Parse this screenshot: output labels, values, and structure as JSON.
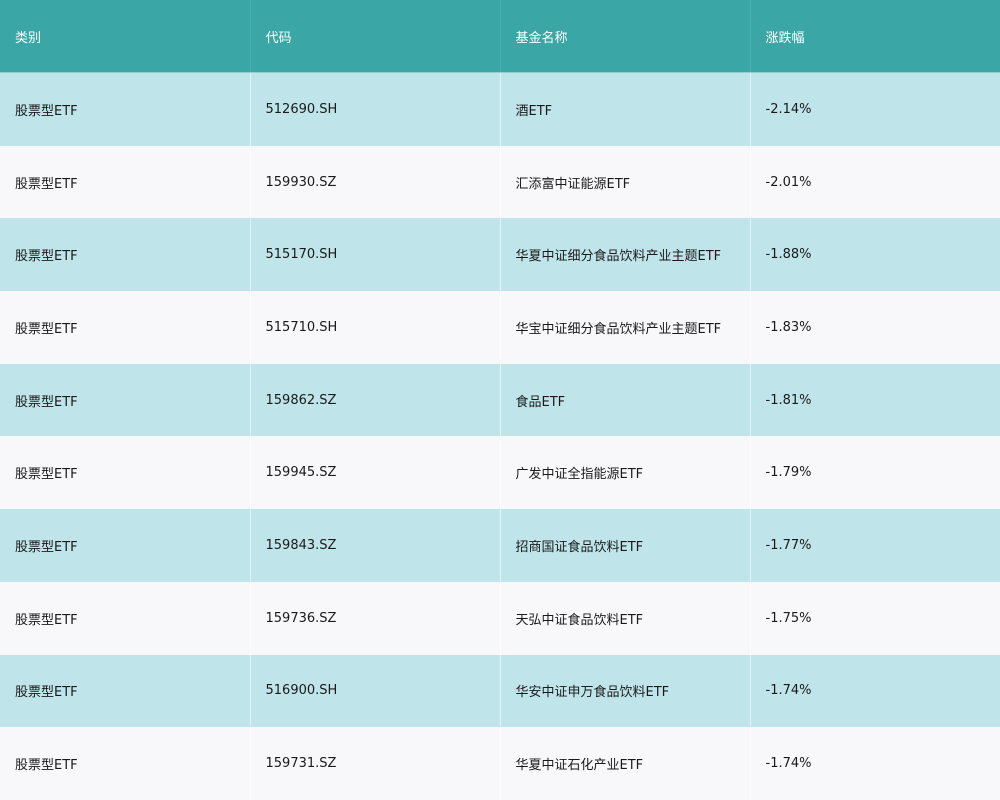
{
  "table": {
    "headers": {
      "category": "类别",
      "code": "代码",
      "name": "基金名称",
      "change": "涨跌幅"
    },
    "rows": [
      {
        "category": "股票型ETF",
        "code": "512690.SH",
        "name": "酒ETF",
        "change": "-2.14%"
      },
      {
        "category": "股票型ETF",
        "code": "159930.SZ",
        "name": "汇添富中证能源ETF",
        "change": "-2.01%"
      },
      {
        "category": "股票型ETF",
        "code": "515170.SH",
        "name": "华夏中证细分食品饮料产业主题ETF",
        "change": "-1.88%"
      },
      {
        "category": "股票型ETF",
        "code": "515710.SH",
        "name": "华宝中证细分食品饮料产业主题ETF",
        "change": "-1.83%"
      },
      {
        "category": "股票型ETF",
        "code": "159862.SZ",
        "name": "食品ETF",
        "change": "-1.81%"
      },
      {
        "category": "股票型ETF",
        "code": "159945.SZ",
        "name": "广发中证全指能源ETF",
        "change": "-1.79%"
      },
      {
        "category": "股票型ETF",
        "code": "159843.SZ",
        "name": "招商国证食品饮料ETF",
        "change": "-1.77%"
      },
      {
        "category": "股票型ETF",
        "code": "159736.SZ",
        "name": "天弘中证食品饮料ETF",
        "change": "-1.75%"
      },
      {
        "category": "股票型ETF",
        "code": "516900.SH",
        "name": "华安中证申万食品饮料ETF",
        "change": "-1.74%"
      },
      {
        "category": "股票型ETF",
        "code": "159731.SZ",
        "name": "华夏中证石化产业ETF",
        "change": "-1.74%"
      }
    ]
  }
}
